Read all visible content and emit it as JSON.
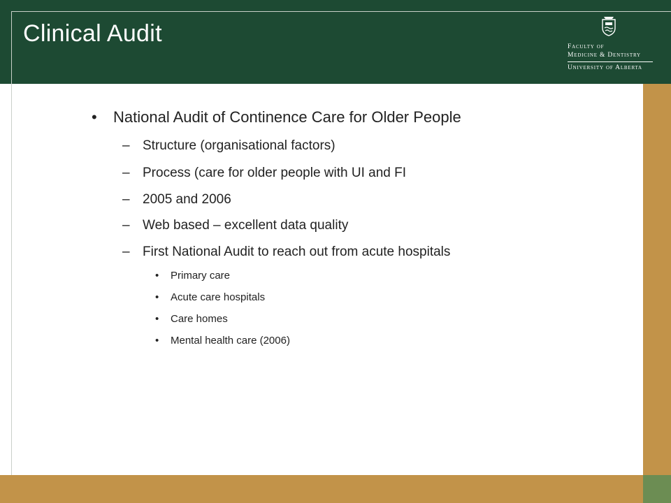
{
  "slide": {
    "title": "Clinical Audit"
  },
  "logo": {
    "line1": "Faculty of",
    "line2": "Medicine & Dentistry",
    "line3": "University of Alberta",
    "crest_icon": "university-crest-icon"
  },
  "colors": {
    "header_green": "#1d4a33",
    "accent_gold": "#c29349",
    "corner_green": "#6c8d53",
    "text": "#222222"
  },
  "content": {
    "heading_bullet": "•",
    "heading": "National Audit of Continence Care for Older People",
    "dash": "–",
    "dot": "•",
    "items": [
      "Structure (organisational factors)",
      "Process (care for older people with UI and FI",
      "2005 and 2006",
      "Web based – excellent data quality",
      "First National Audit to reach out from acute hospitals"
    ],
    "subitems": [
      "Primary care",
      "Acute care hospitals",
      "Care homes",
      "Mental health care (2006)"
    ]
  }
}
